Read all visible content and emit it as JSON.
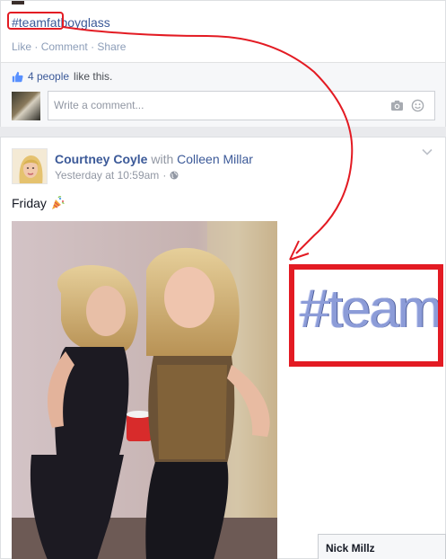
{
  "previous_post": {
    "hashtag_text": "#teamfatboyglass",
    "actions": [
      "Like",
      "Comment",
      "Share"
    ],
    "likes_text": "4 people like this.",
    "likes_link": "4 people",
    "likes_rest": "like this.",
    "comment_placeholder": "Write a comment..."
  },
  "post": {
    "author": "Courtney Coyle",
    "with_text": "with",
    "tagged": "Colleen Millar",
    "timestamp": "Yesterday at 10:59am",
    "separator": "·",
    "status": "Friday",
    "status_icon": "party-popper-icon",
    "privacy_icon": "globe-icon"
  },
  "annotation": {
    "zoom_text": "#teamfat",
    "color": "#e31b23"
  },
  "chat": {
    "contact_name": "Nick Millz"
  },
  "colors": {
    "link": "#3b5998",
    "meta": "#9197a3",
    "background": "#e9eaed",
    "annotation_red": "#e31b23"
  }
}
